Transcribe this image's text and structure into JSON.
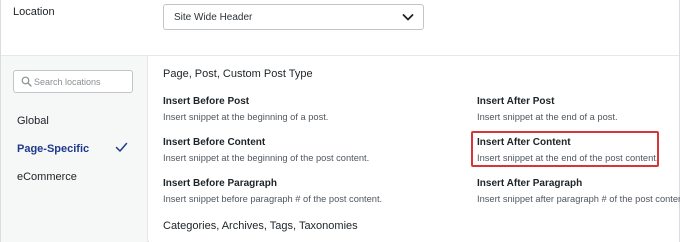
{
  "location": {
    "label": "Location",
    "selected": "Site Wide Header"
  },
  "sidebar": {
    "search_placeholder": "Search locations",
    "items": [
      {
        "label": "Global",
        "active": false
      },
      {
        "label": "Page-Specific",
        "active": true
      },
      {
        "label": "eCommerce",
        "active": false
      }
    ]
  },
  "sections": [
    {
      "title": "Page, Post, Custom Post Type",
      "options": [
        {
          "title": "Insert Before Post",
          "desc": "Insert snippet at the beginning of a post."
        },
        {
          "title": "Insert After Post",
          "desc": "Insert snippet at the end of a post."
        },
        {
          "title": "Insert Before Content",
          "desc": "Insert snippet at the beginning of the post content."
        },
        {
          "title": "Insert After Content",
          "desc": "Insert snippet at the end of the post content.",
          "highlighted": true
        },
        {
          "title": "Insert Before Paragraph",
          "desc": "Insert snippet before paragraph # of the post content."
        },
        {
          "title": "Insert After Paragraph",
          "desc": "Insert snippet after paragraph # of the post content."
        }
      ]
    },
    {
      "title": "Categories, Archives, Tags, Taxonomies",
      "options": []
    }
  ],
  "colors": {
    "active": "#1e3a8a",
    "highlight": "#d63638"
  },
  "icons": {
    "select": "chevron-down-icon",
    "search": "search-icon",
    "active_item": "checkmark-icon"
  }
}
